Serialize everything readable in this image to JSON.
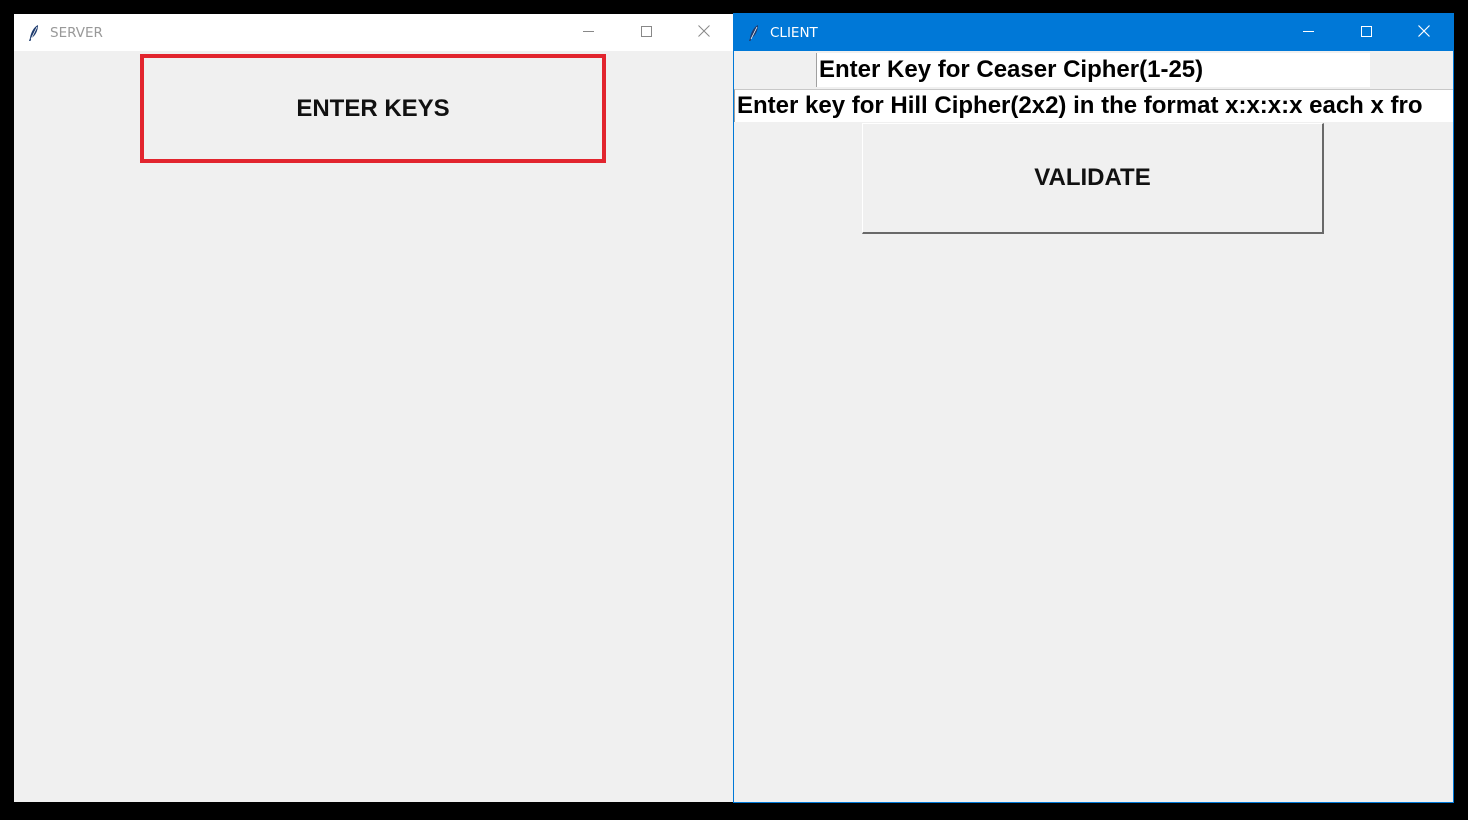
{
  "server": {
    "title": "SERVER",
    "app_icon": "feather-icon",
    "enter_keys_label": "ENTER KEYS",
    "highlight_color": "#e2252e"
  },
  "client": {
    "title": "CLIENT",
    "app_icon": "feather-icon",
    "caesar_key_value": "Enter Key for Ceaser Cipher(1-25)",
    "hill_key_value": "Enter key for Hill Cipher(2x2) in the format x:x:x:x each x fro",
    "validate_label": "VALIDATE",
    "active_titlebar_color": "#0078d7"
  },
  "caption_buttons": [
    "minimize-icon",
    "maximize-icon",
    "close-icon"
  ]
}
